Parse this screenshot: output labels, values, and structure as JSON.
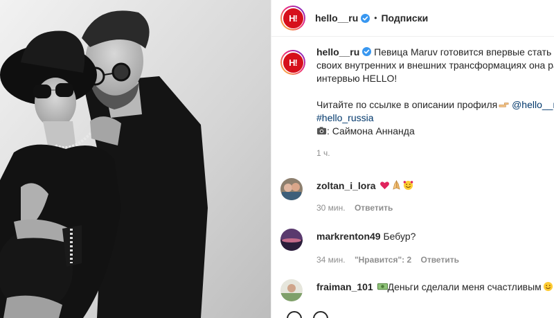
{
  "post": {
    "username": "hello__ru",
    "follow_label": "Подписки",
    "dot": "•",
    "logo_text": "H!"
  },
  "caption": {
    "username": "hello__ru",
    "line1": "Певица Maruv готовится впервые стать м",
    "line2": "своих внутренних и внешних трансформациях она ра",
    "line3": "интервью HELLO!",
    "line4_text": "Читайте по ссылке в описании профиля",
    "line4_mention": "@hello__ru",
    "hashtag": "#hello_russia",
    "photo_credit": ": Саймона Аннанда",
    "time": "1 ч."
  },
  "comments": [
    {
      "username": "zoltan_i_lora",
      "text": "",
      "emojis": [
        "heart-emoji",
        "praying-hands-emoji",
        "smiling-face-with-hearts-emoji"
      ],
      "time": "30 мин.",
      "reply_label": "Ответить"
    },
    {
      "username": "markrenton49",
      "text": "Бебур?",
      "time": "34 мин.",
      "likes_label": "\"Нравится\": 2",
      "reply_label": "Ответить"
    },
    {
      "username": "fraiman_101",
      "text": "Деньги сделали меня счастливым",
      "emojis": [
        "dollar-banknote-emoji",
        "smiling-face-emoji"
      ]
    }
  ],
  "colors": {
    "brand_red": "#d6101c",
    "verified_blue": "#3897f0",
    "link_blue": "#00376b",
    "meta_gray": "#8e8e8e"
  }
}
